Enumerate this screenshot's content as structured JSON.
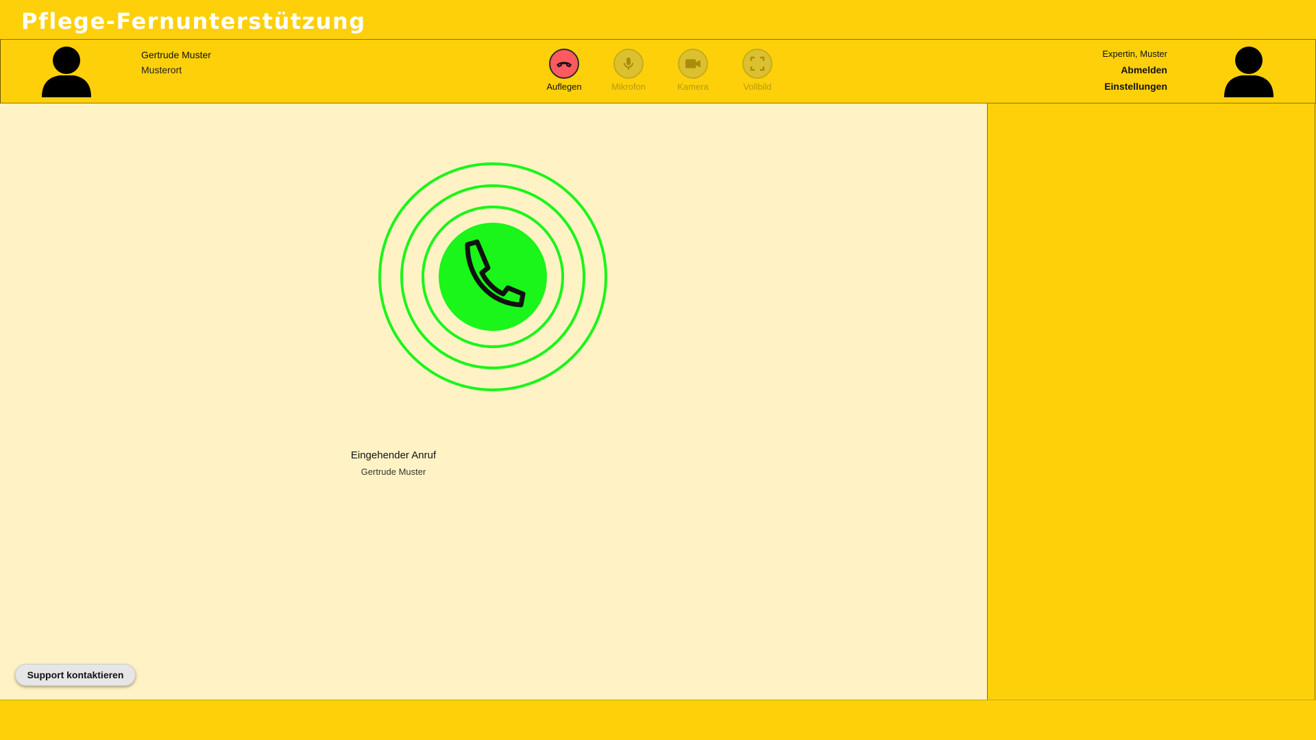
{
  "app": {
    "title": "Pflege-Fernunterstützung"
  },
  "caller": {
    "name": "Gertrude Muster",
    "location": "Musterort"
  },
  "controls": {
    "hangup_label": "Auflegen",
    "mic_label": "Mikrofon",
    "camera_label": "Kamera",
    "fullscreen_label": "Vollbild"
  },
  "user": {
    "name": "Expertin, Muster",
    "logout_label": "Abmelden",
    "settings_label": "Einstellungen"
  },
  "call": {
    "status": "Eingehender Anruf",
    "caller_name": "Gertrude Muster"
  },
  "support": {
    "label": "Support kontaktieren"
  },
  "icons": {
    "hangup": "phone-hangup-icon",
    "mic": "microphone-icon",
    "camera": "video-camera-icon",
    "fullscreen": "fullscreen-icon",
    "incoming_call": "phone-icon",
    "avatar": "user-avatar-icon"
  },
  "colors": {
    "brand_yellow": "#fed00a",
    "content_bg": "#fff3c5",
    "accept_green": "#1af51a",
    "hangup_red": "#fe5a60",
    "title_text": "#ffffff"
  }
}
